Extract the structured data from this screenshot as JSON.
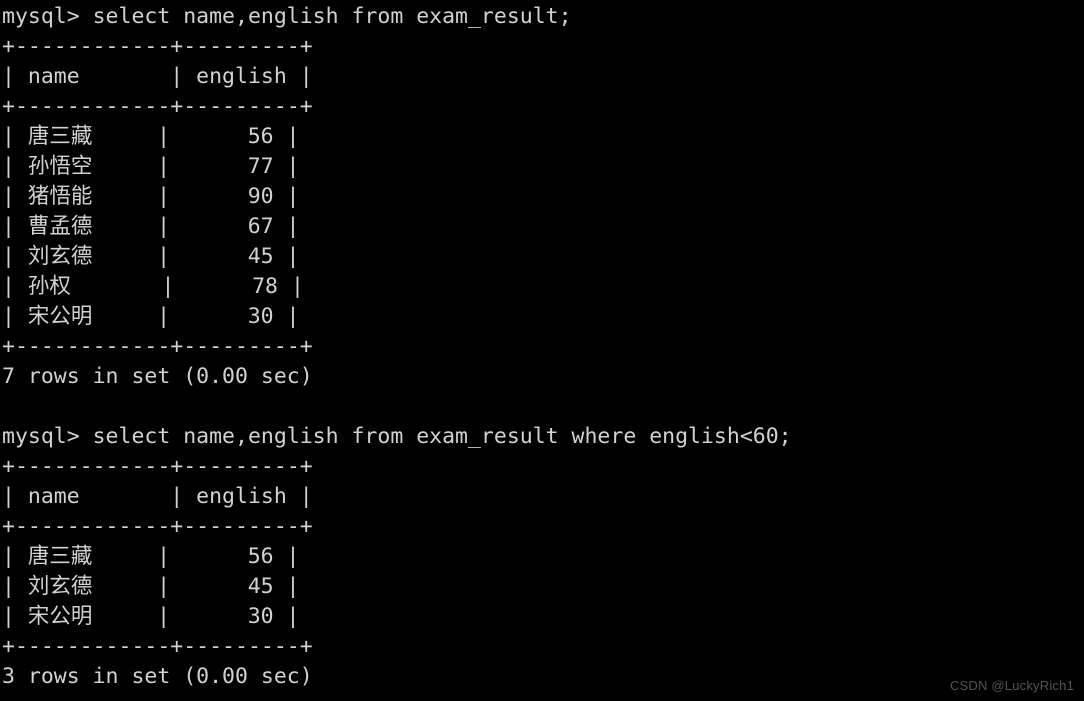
{
  "terminal": {
    "background_color": "#000000",
    "text_color": "#d2d2d2",
    "prompt": "mysql>",
    "lines": [
      "mysql> select name,english from exam_result;",
      "+------------+---------+",
      "| name       | english |",
      "+------------+---------+",
      "| 唐三藏     |      56 |",
      "| 孙悟空     |      77 |",
      "| 猪悟能     |      90 |",
      "| 曹孟德     |      67 |",
      "| 刘玄德     |      45 |",
      "| 孙权       |      78 |",
      "| 宋公明     |      30 |",
      "+------------+---------+",
      "7 rows in set (0.00 sec)",
      "",
      "mysql> select name,english from exam_result where english<60;",
      "+------------+---------+",
      "| name       | english |",
      "+------------+---------+",
      "| 唐三藏     |      56 |",
      "| 刘玄德     |      45 |",
      "| 宋公明     |      30 |",
      "+------------+---------+",
      "3 rows in set (0.00 sec)"
    ]
  },
  "queries": [
    {
      "sql": "select name,english from exam_result;",
      "result_columns": [
        "name",
        "english"
      ],
      "rows": [
        {
          "name": "唐三藏",
          "english": "56"
        },
        {
          "name": "孙悟空",
          "english": "77"
        },
        {
          "name": "猪悟能",
          "english": "90"
        },
        {
          "name": "曹孟德",
          "english": "67"
        },
        {
          "name": "刘玄德",
          "english": "45"
        },
        {
          "name": "孙权",
          "english": "78"
        },
        {
          "name": "宋公明",
          "english": "30"
        }
      ],
      "status": "7 rows in set (0.00 sec)"
    },
    {
      "sql": "select name,english from exam_result where english<60;",
      "result_columns": [
        "name",
        "english"
      ],
      "rows": [
        {
          "name": "唐三藏",
          "english": "56"
        },
        {
          "name": "刘玄德",
          "english": "45"
        },
        {
          "name": "宋公明",
          "english": "30"
        }
      ],
      "status": "3 rows in set (0.00 sec)"
    }
  ],
  "watermark": {
    "text": "CSDN @LuckyRich1",
    "color": "#545454"
  }
}
